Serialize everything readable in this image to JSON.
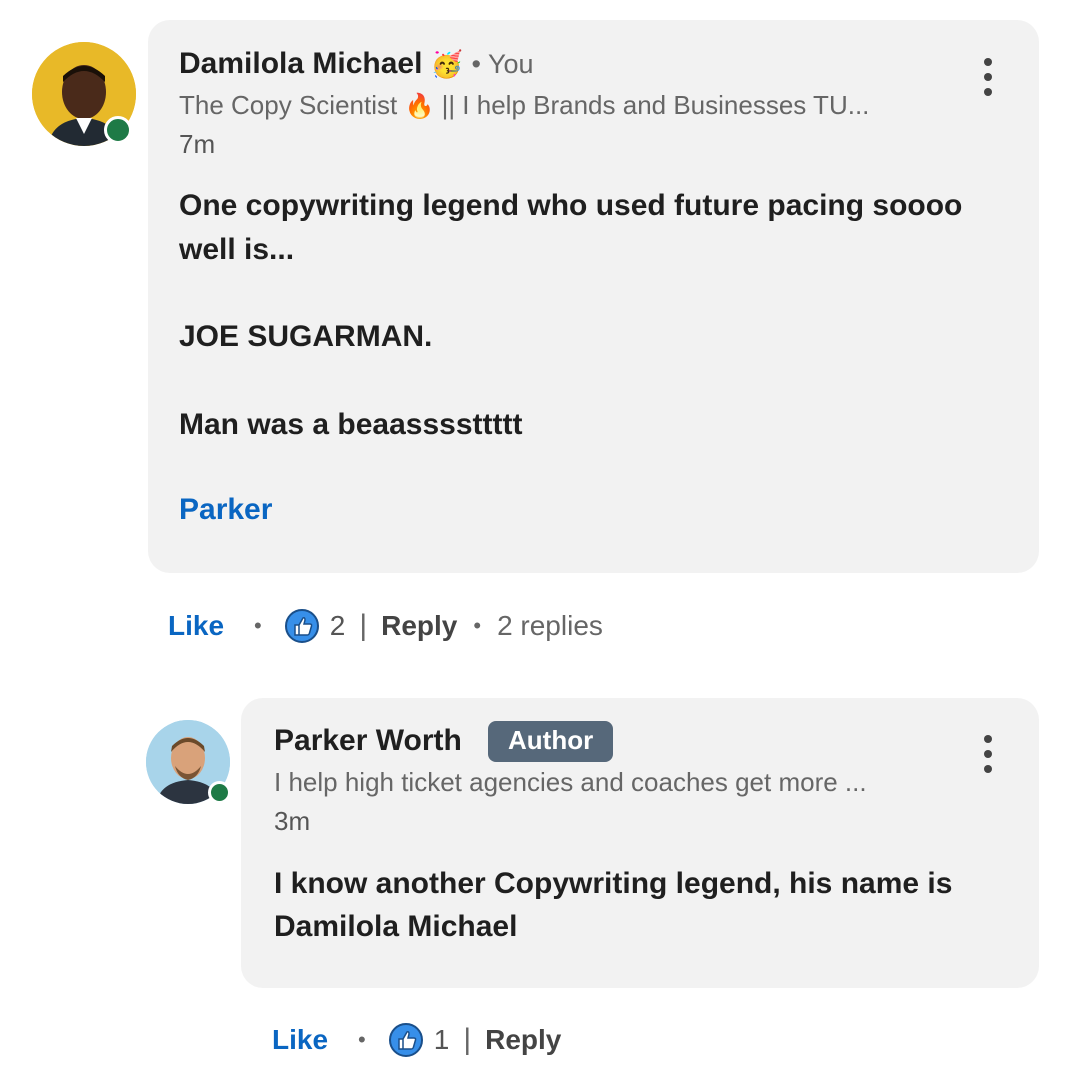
{
  "comment": {
    "author_name": "Damilola Michael",
    "name_emoji": "🥳",
    "you_label": "• You",
    "headline_prefix": "The Copy Scientist",
    "headline_suffix": "|| I help Brands and Businesses TU...",
    "time": "7m",
    "body_line1": "One copywriting legend who used future pacing soooo",
    "body_line2": "well is...",
    "body_line3": "JOE SUGARMAN.",
    "body_line4": "Man was a beaassssttttt",
    "mention": "Parker",
    "actions": {
      "like": "Like",
      "reaction_count": "2",
      "reply": "Reply",
      "replies": "2 replies"
    }
  },
  "reply": {
    "author_name": "Parker Worth",
    "badge": "Author",
    "headline": "I help high ticket agencies and coaches get more ...",
    "time": "3m",
    "body_line1": "I know another Copywriting legend, his name is",
    "body_line2": "Damilola Michael",
    "actions": {
      "like": "Like",
      "reaction_count": "1",
      "reply": "Reply"
    }
  },
  "colors": {
    "link_blue": "#0a66c2",
    "bubble_bg": "#f2f2f2",
    "badge_bg": "#56687a",
    "online_green": "#1e7a46",
    "avatar1_bg": "#e8b928",
    "avatar2_bg": "#a8d4ea"
  }
}
